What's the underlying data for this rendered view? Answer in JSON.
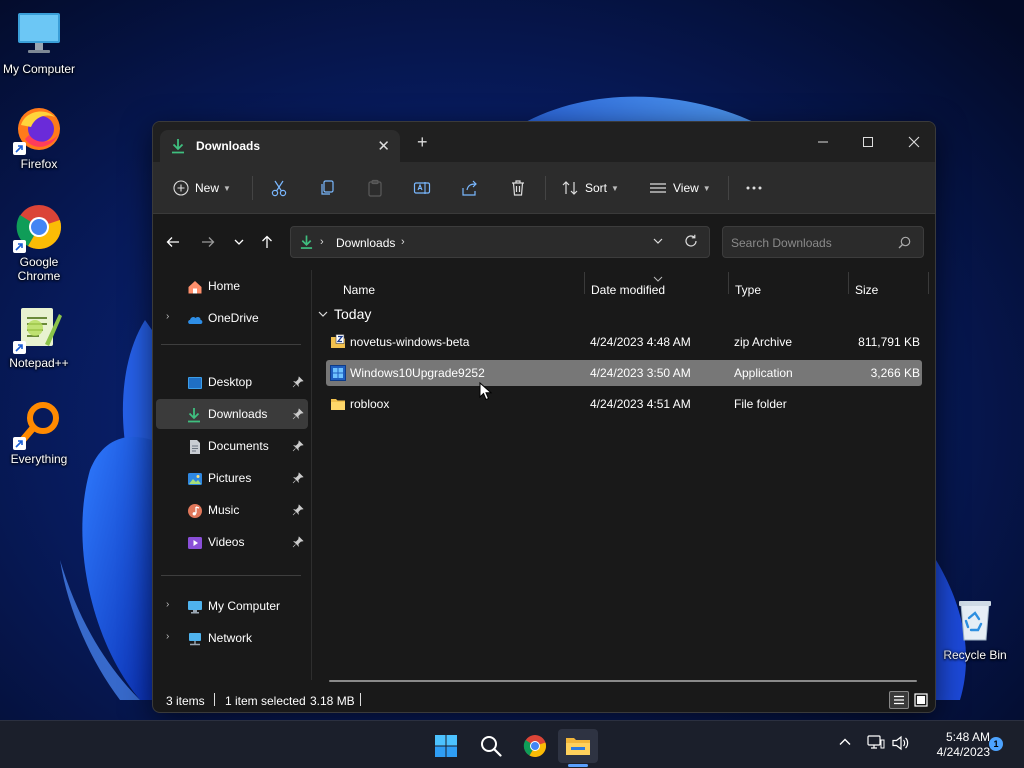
{
  "desktop": {
    "icons": [
      {
        "label": "My Computer"
      },
      {
        "label": "Firefox"
      },
      {
        "label": "Google Chrome"
      },
      {
        "label": "Notepad++"
      },
      {
        "label": "Everything"
      },
      {
        "label": "Recycle Bin"
      }
    ]
  },
  "window": {
    "tab_title": "Downloads",
    "commands": {
      "new": "New",
      "sort": "Sort",
      "view": "View"
    },
    "address": {
      "folder": "Downloads"
    },
    "search": {
      "placeholder": "Search Downloads"
    },
    "sidebar": {
      "items": [
        {
          "label": "Home"
        },
        {
          "label": "OneDrive"
        },
        {
          "label": "Desktop"
        },
        {
          "label": "Downloads"
        },
        {
          "label": "Documents"
        },
        {
          "label": "Pictures"
        },
        {
          "label": "Music"
        },
        {
          "label": "Videos"
        },
        {
          "label": "My Computer"
        },
        {
          "label": "Network"
        }
      ]
    },
    "columns": {
      "name": "Name",
      "date": "Date modified",
      "type": "Type",
      "size": "Size"
    },
    "group": "Today",
    "files": [
      {
        "name": "novetus-windows-beta",
        "date": "4/24/2023 4:48 AM",
        "type": "zip Archive",
        "size": "811,791 KB"
      },
      {
        "name": "Windows10Upgrade9252",
        "date": "4/24/2023 3:50 AM",
        "type": "Application",
        "size": "3,266 KB"
      },
      {
        "name": "robloox",
        "date": "4/24/2023 4:51 AM",
        "type": "File folder",
        "size": ""
      }
    ],
    "status": {
      "items": "3 items",
      "selected": "1 item selected",
      "size": "3.18 MB"
    }
  },
  "taskbar": {
    "time": "5:48 AM",
    "date": "4/24/2023",
    "notifications": "1"
  },
  "colors": {
    "selection": "#777777",
    "accent": "#5aa0ff",
    "downloads_green": "#3fbf7f"
  }
}
